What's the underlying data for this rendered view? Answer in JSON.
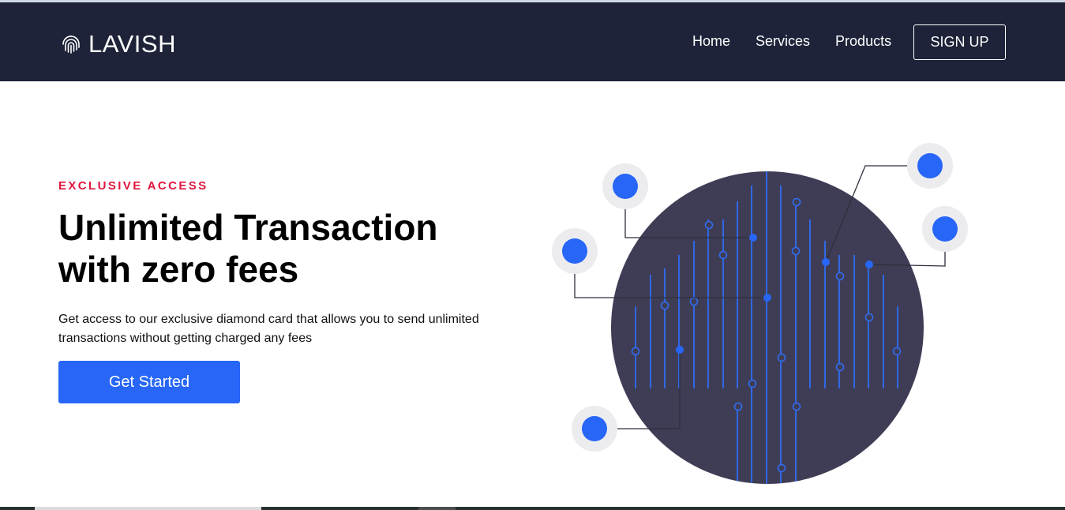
{
  "brand": {
    "name": "LAVISH",
    "icon": "fingerprint-icon"
  },
  "nav": {
    "links": [
      "Home",
      "Services",
      "Products"
    ],
    "signup_label": "SIGN UP"
  },
  "hero": {
    "eyebrow": "EXCLUSIVE ACCESS",
    "headline_lines": [
      "Unlimited Transaction",
      "with zero fees"
    ],
    "description_lines": [
      "Get access to our exclusive diamond card that allows you to send unlimited",
      "transactions without getting charged any fees"
    ],
    "cta_label": "Get Started"
  },
  "colors": {
    "navbar_bg": "#1e2339",
    "accent_blue": "#2766f6",
    "eyebrow_red": "#e0173f",
    "circle_fill": "#3f3d56",
    "halo_gray": "#ececef"
  }
}
